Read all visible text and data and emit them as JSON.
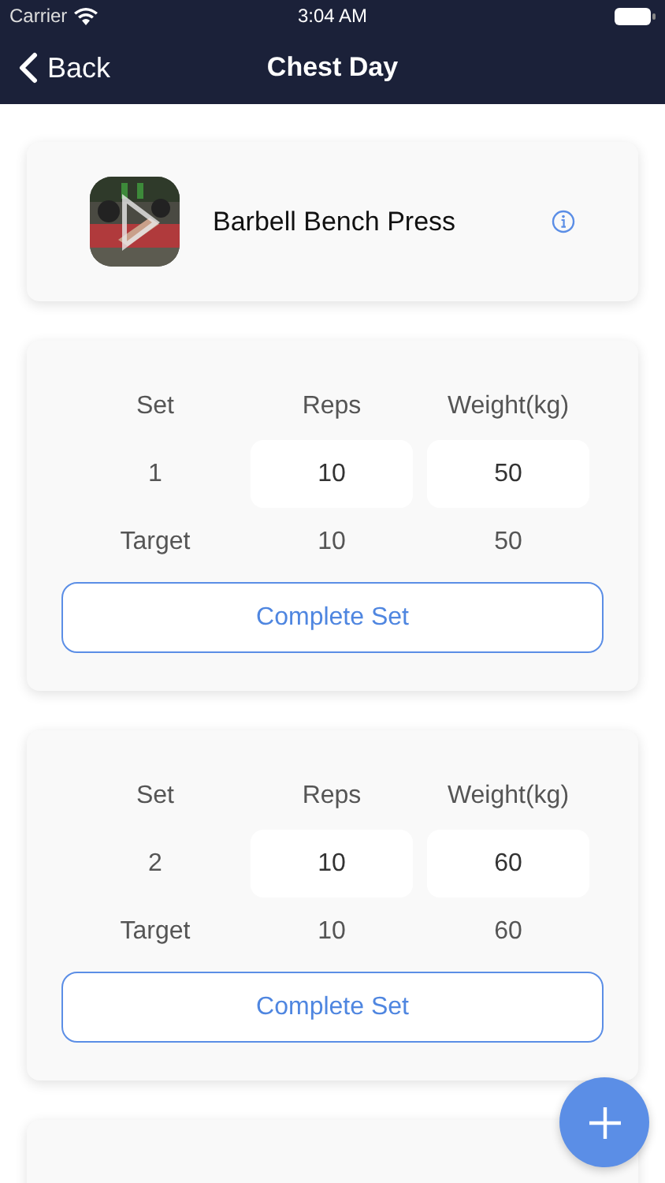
{
  "status_bar": {
    "carrier": "Carrier",
    "time": "3:04 AM"
  },
  "nav": {
    "back": "Back",
    "title": "Chest Day"
  },
  "exercise": {
    "name": "Barbell Bench Press"
  },
  "sets": [
    {
      "columns": [
        "Set",
        "Reps",
        "Weight(kg)"
      ],
      "number": "1",
      "reps": "10",
      "weight": "50",
      "target_label": "Target",
      "target_reps": "10",
      "target_weight": "50",
      "button": "Complete Set"
    },
    {
      "columns": [
        "Set",
        "Reps",
        "Weight(kg)"
      ],
      "number": "2",
      "reps": "10",
      "weight": "60",
      "target_label": "Target",
      "target_reps": "10",
      "target_weight": "60",
      "button": "Complete Set"
    }
  ],
  "more_sets_below": true
}
